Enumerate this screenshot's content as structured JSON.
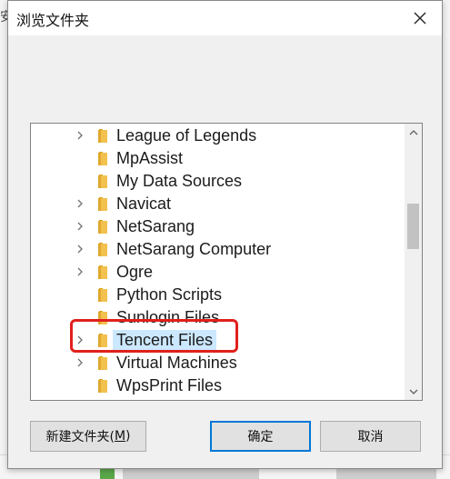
{
  "dialog": {
    "title": "浏览文件夹",
    "close_icon": "close-icon"
  },
  "background": {
    "left_fragment": "安"
  },
  "folders": [
    {
      "name": "League of Legends",
      "expandable": true,
      "selected": false
    },
    {
      "name": "MpAssist",
      "expandable": false,
      "selected": false
    },
    {
      "name": "My Data Sources",
      "expandable": false,
      "selected": false
    },
    {
      "name": "Navicat",
      "expandable": true,
      "selected": false
    },
    {
      "name": "NetSarang",
      "expandable": true,
      "selected": false
    },
    {
      "name": "NetSarang Computer",
      "expandable": true,
      "selected": false
    },
    {
      "name": "Ogre",
      "expandable": true,
      "selected": false
    },
    {
      "name": "Python Scripts",
      "expandable": false,
      "selected": false
    },
    {
      "name": "Sunlogin Files",
      "expandable": false,
      "selected": false
    },
    {
      "name": "Tencent Files",
      "expandable": true,
      "selected": true
    },
    {
      "name": "Virtual Machines",
      "expandable": true,
      "selected": false
    },
    {
      "name": "WpsPrint Files",
      "expandable": false,
      "selected": false
    }
  ],
  "buttons": {
    "new_folder_prefix": "新建文件夹(",
    "new_folder_accel": "M",
    "new_folder_suffix": ")",
    "ok": "确定",
    "cancel": "取消"
  },
  "colors": {
    "selection": "#cce8ff",
    "highlight_box": "#e0201c",
    "primary_border": "#0078d7",
    "folder": "#f2c14e"
  }
}
